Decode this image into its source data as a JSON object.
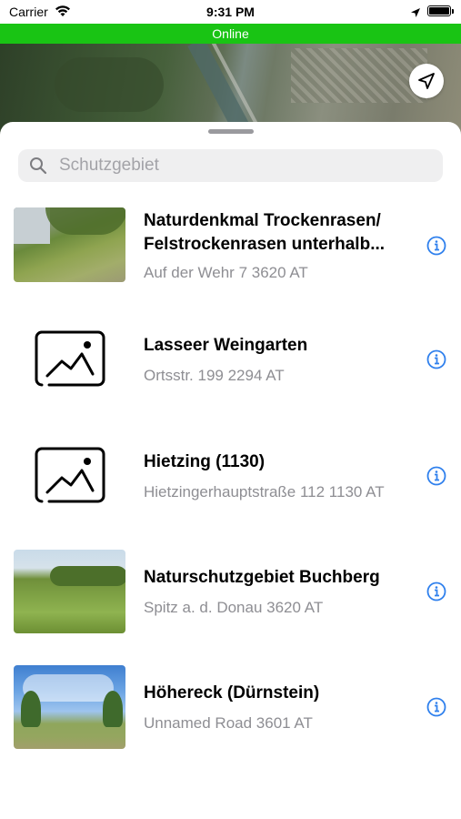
{
  "status_bar": {
    "carrier": "Carrier",
    "time": "9:31 PM"
  },
  "banner": {
    "text": "Online",
    "color": "#19c414"
  },
  "search": {
    "placeholder": "Schutzgebiet",
    "value": ""
  },
  "items": [
    {
      "title": "Naturdenkmal Trockenrasen/ Felstrockenrasen unterhalb...",
      "address": "Auf der Wehr 7 3620 AT",
      "image": "photo"
    },
    {
      "title": "Lasseer Weingarten",
      "address": "Ortsstr. 199 2294 AT",
      "image": "placeholder-image-icon"
    },
    {
      "title": "Hietzing (1130)",
      "address": "Hietzingerhauptstraße 112 1130 AT",
      "image": "placeholder-image-icon"
    },
    {
      "title": "Naturschutzgebiet Buchberg",
      "address": "Spitz a. d. Donau 3620 AT",
      "image": "photo"
    },
    {
      "title": "Höhereck (Dürnstein)",
      "address": "Unnamed Road 3601 AT",
      "image": "photo"
    }
  ],
  "icons": {
    "info": "info-icon",
    "locate": "location-arrow-icon",
    "search": "search-icon"
  },
  "colors": {
    "accent": "#2f80ed",
    "secondary_text": "#8e8e93"
  }
}
